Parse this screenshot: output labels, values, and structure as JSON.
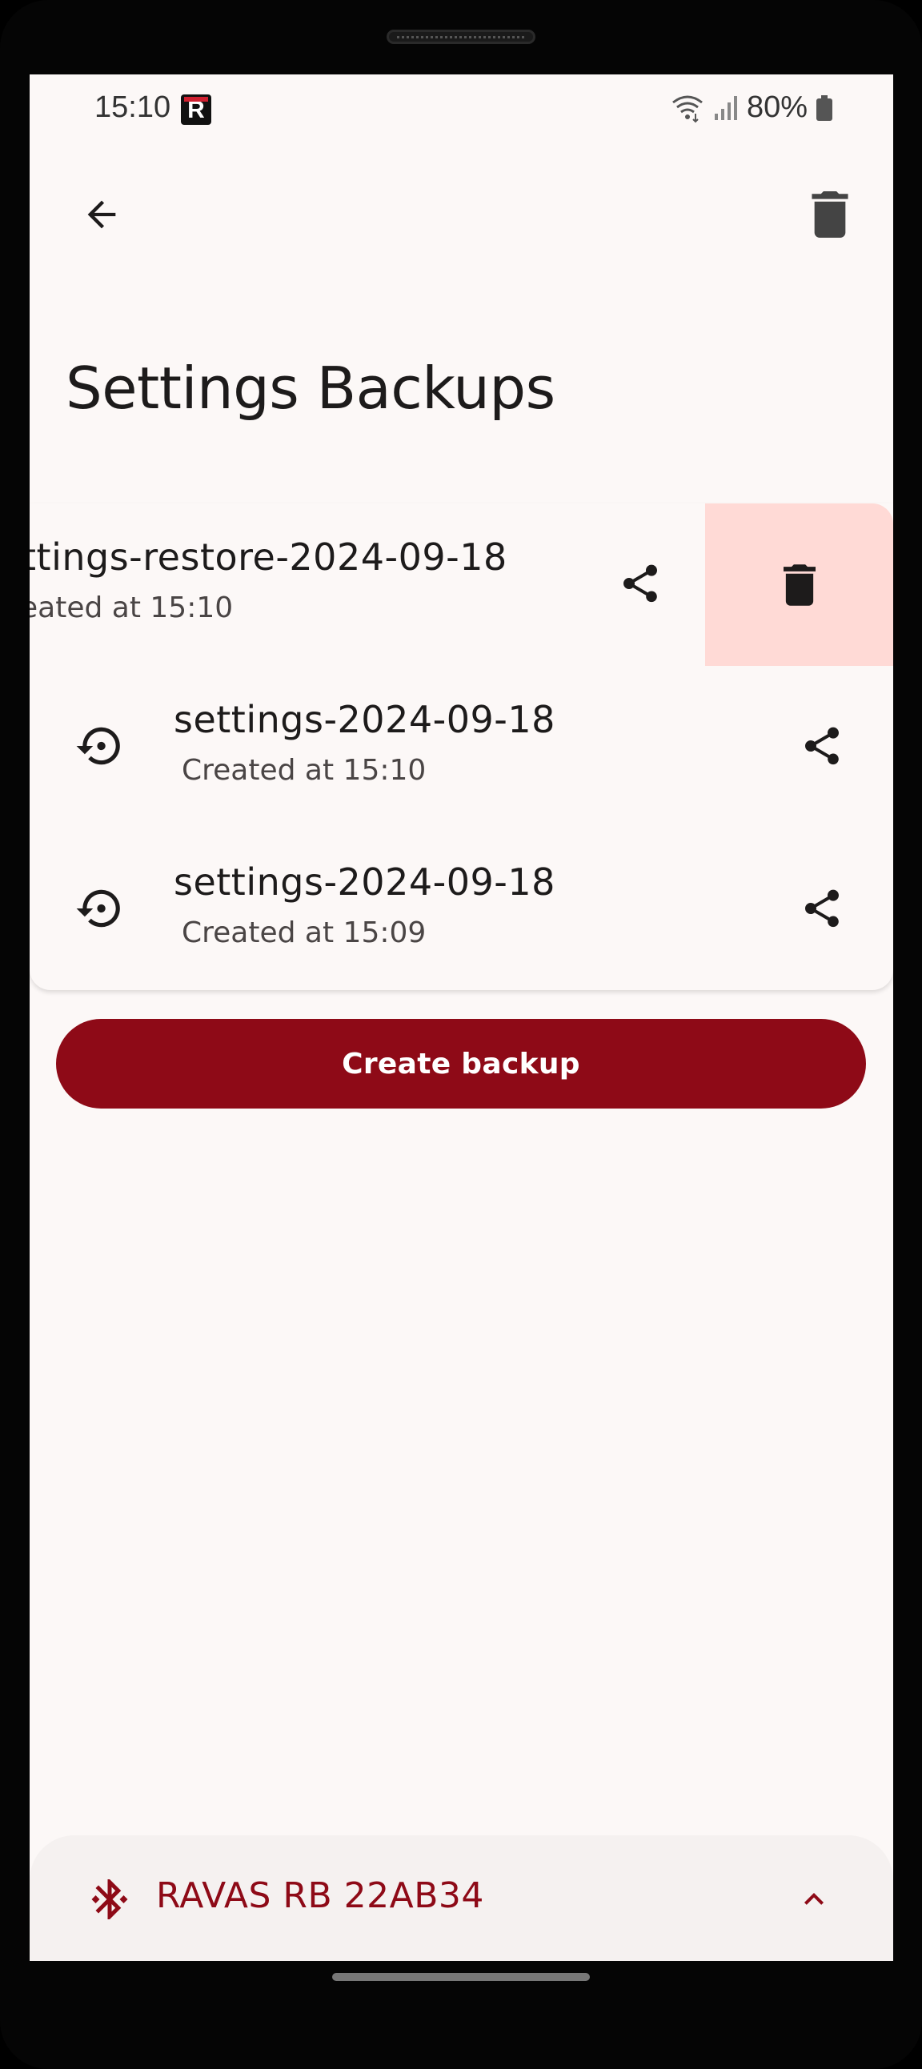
{
  "status_bar": {
    "time": "15:10",
    "app_badge": "R",
    "battery": "80%"
  },
  "app_bar": {
    "back_icon": "arrow-back-icon",
    "delete_icon": "trash-icon"
  },
  "page": {
    "title": "Settings Backups"
  },
  "backups": [
    {
      "name": "ttings-restore-2024-09-18",
      "created": "eated at 15:10",
      "state": "swiped"
    },
    {
      "name": "settings-2024-09-18",
      "created": "Created at 15:10",
      "state": "normal"
    },
    {
      "name": "settings-2024-09-18",
      "created": "Created at 15:09",
      "state": "normal"
    }
  ],
  "actions": {
    "create_backup": "Create backup"
  },
  "device": {
    "name": "RAVAS RB 22AB34",
    "icon": "bluetooth-connected-icon"
  },
  "colors": {
    "accent": "#8e0a17",
    "background": "#fcf8f7",
    "delete_bg": "#ffdad6"
  }
}
